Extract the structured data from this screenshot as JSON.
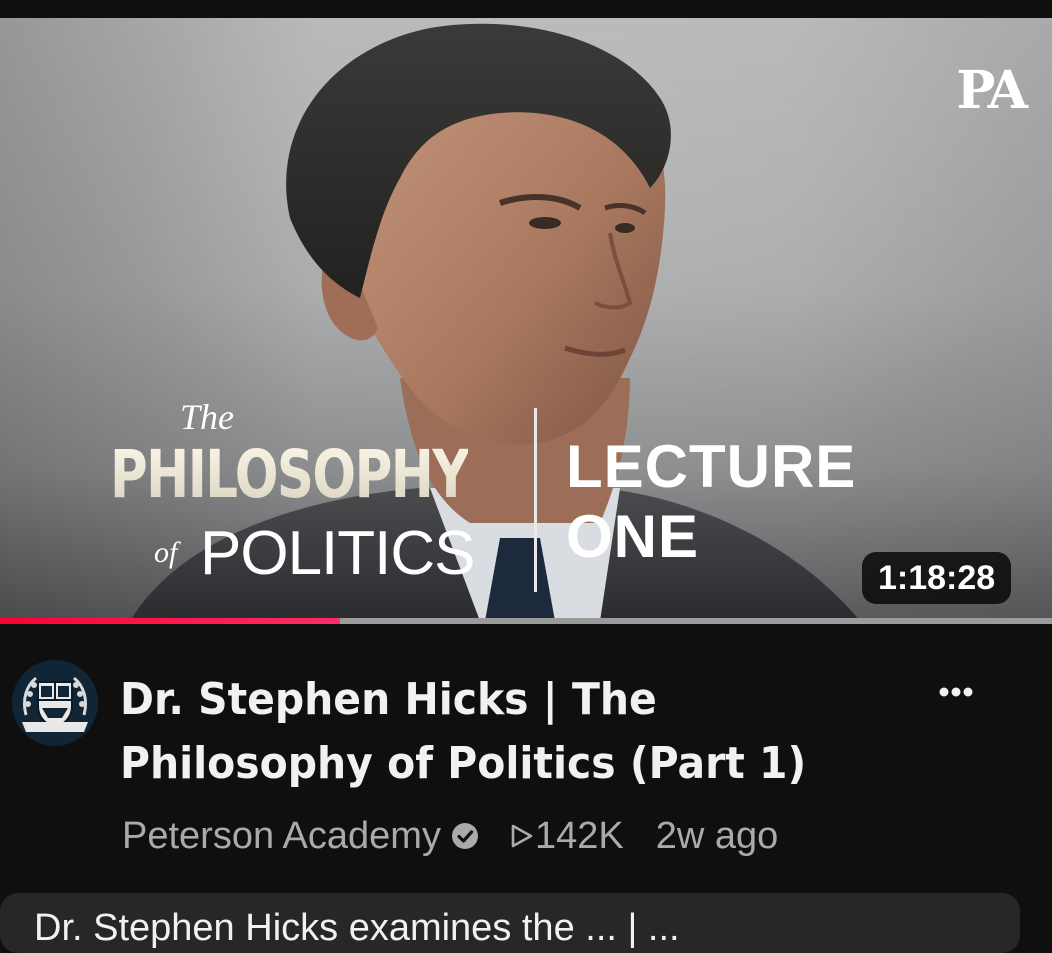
{
  "thumbnail": {
    "logo": "PA",
    "title_the": "The",
    "title_philosophy": "PHILOSOPHY",
    "title_of": "of",
    "title_politics": "POLITICS",
    "lecture_line1": "LECTURE",
    "lecture_line2": "ONE",
    "duration": "1:18:28",
    "watch_progress": 0.323
  },
  "video": {
    "title": "Dr. Stephen Hicks | The Philosophy of Politics (Part 1)",
    "channel": "Peterson Academy",
    "channel_verified": true,
    "views": "142K",
    "age": "2w ago",
    "more_icon": "more-vert-icon"
  },
  "next_card": {
    "text": "Dr. Stephen Hicks examines the ... | ..."
  },
  "colors": {
    "background": "#0f0f0f",
    "progress": "#ff0033",
    "title": "#f1f1f1",
    "meta": "#aaaaaa"
  }
}
